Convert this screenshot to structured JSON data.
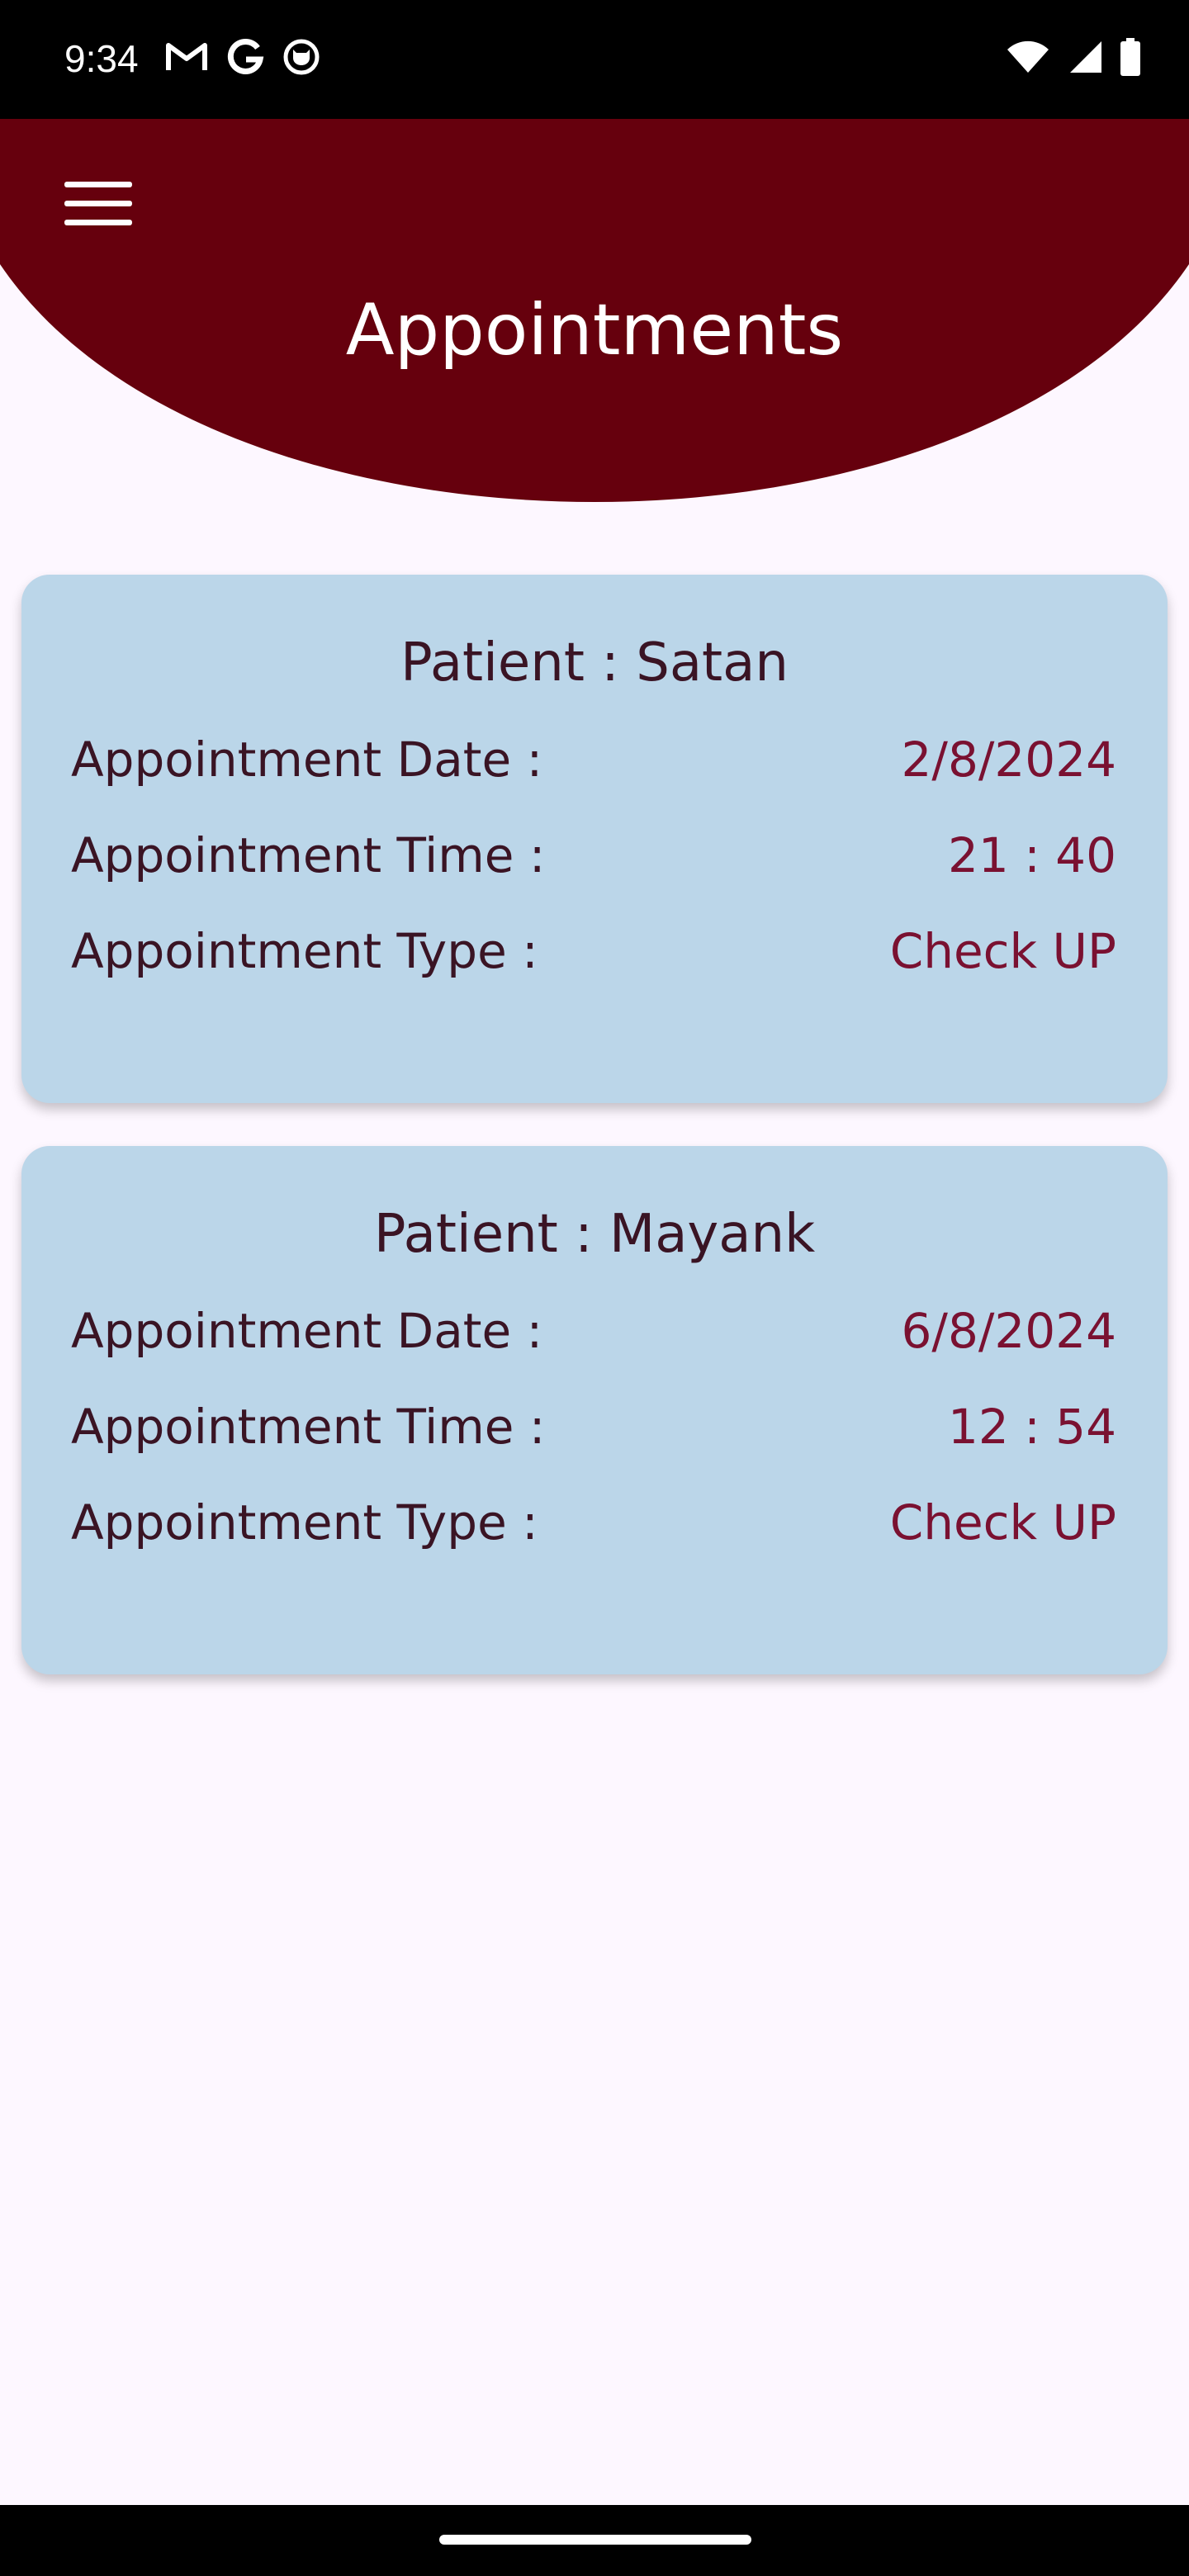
{
  "status_bar": {
    "time": "9:34",
    "left_icons": [
      "gmail-icon",
      "google-icon",
      "github-icon"
    ],
    "right_icons": [
      "wifi-icon",
      "signal-icon",
      "battery-icon"
    ]
  },
  "header": {
    "title": "Appointments",
    "menu_icon": "hamburger-menu-icon",
    "color": "#66000D"
  },
  "appointments": [
    {
      "patient": "Patient : Satan",
      "date_label": "Appointment Date :",
      "date": "2/8/2024",
      "time_label": "Appointment Time :",
      "time": "21 : 40",
      "type_label": "Appointment Type :",
      "type": "Check UP"
    },
    {
      "patient": "Patient : Mayank",
      "date_label": "Appointment Date :",
      "date": "6/8/2024",
      "time_label": "Appointment Time :",
      "time": "12 : 54",
      "type_label": "Appointment Type :",
      "type": "Check UP"
    }
  ],
  "colors": {
    "background": "#FDF7FF",
    "card": "#BBD6E9",
    "label_text": "#3A1424",
    "value_text": "#7A1131"
  }
}
